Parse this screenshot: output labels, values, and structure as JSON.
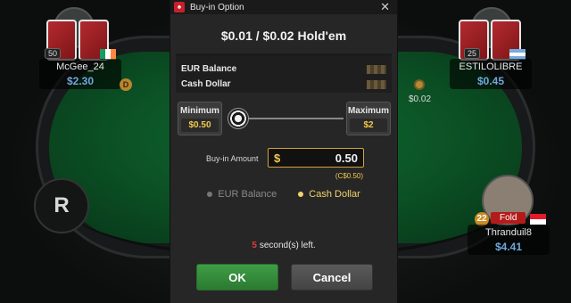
{
  "modal": {
    "title": "Buy-in Option",
    "logo_glyph": "♠",
    "close_glyph": "✕",
    "game": "$0.01 / $0.02 Hold'em",
    "balances": [
      {
        "label": "EUR Balance"
      },
      {
        "label": "Cash Dollar"
      }
    ],
    "minimum": {
      "label": "Minimum",
      "value": "$0.50"
    },
    "maximum": {
      "label": "Maximum",
      "value": "$2"
    },
    "slider_position": 0,
    "buyin_label": "Buy-in Amount",
    "currency_symbol": "$",
    "amount": "0.50",
    "converted": "(C$0.50)",
    "options": [
      {
        "label": "EUR Balance",
        "selected": false
      },
      {
        "label": "Cash Dollar",
        "selected": true
      }
    ],
    "countdown_number": "5",
    "countdown_text": "second(s) left.",
    "ok_label": "OK",
    "cancel_label": "Cancel"
  },
  "players": [
    {
      "name": "McGee_24",
      "stack": "$2.30",
      "level": "50",
      "flag": "ireland"
    },
    {
      "name": "ESTILOLIBRE",
      "stack": "$0.45",
      "level": "25",
      "flag": "argentina"
    },
    {
      "name": "Thranduil8",
      "stack": "$4.41",
      "level": "22",
      "status": "Fold",
      "flag": "indonesia"
    }
  ],
  "table": {
    "bet_amount": "$0.02",
    "dealer_glyph": "D",
    "r_button": "R"
  },
  "colors": {
    "accent_gold": "#f2c94c",
    "ok_green": "#3f9d45",
    "countdown_red": "#e23c3c",
    "stack_blue": "#6fa8dc"
  }
}
